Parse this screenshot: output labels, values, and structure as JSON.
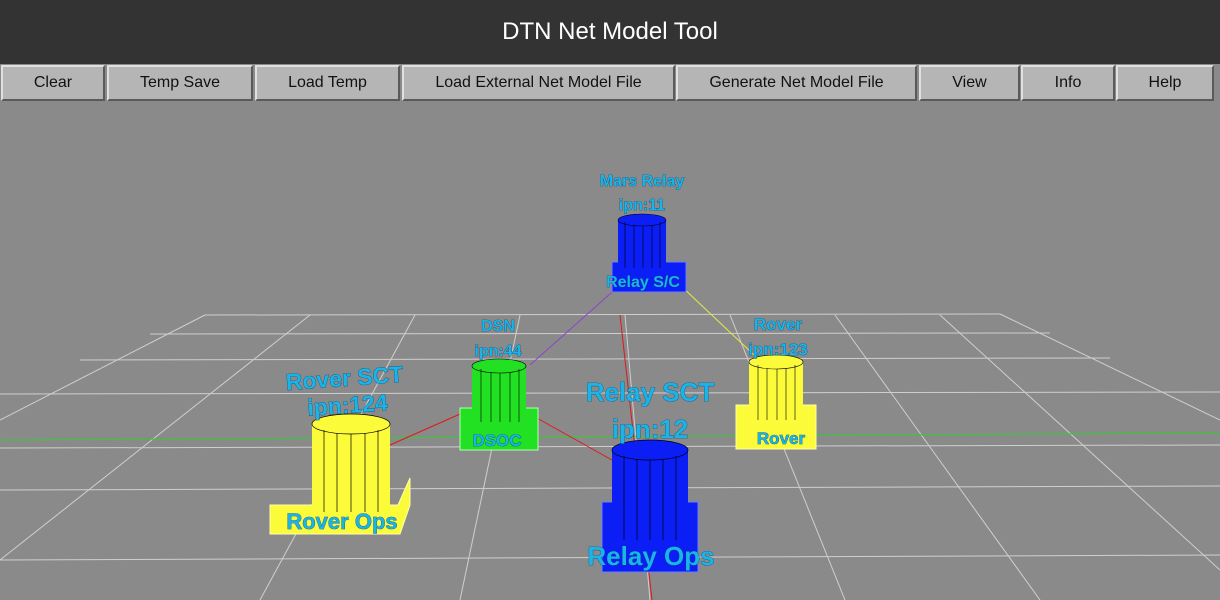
{
  "app": {
    "title": "DTN Net Model Tool"
  },
  "toolbar": {
    "buttons": [
      {
        "id": "clear",
        "label": "Clear"
      },
      {
        "id": "temp-save",
        "label": "Temp Save"
      },
      {
        "id": "load-temp",
        "label": "Load Temp"
      },
      {
        "id": "load-external",
        "label": "Load External Net Model File"
      },
      {
        "id": "generate",
        "label": "Generate Net Model File"
      },
      {
        "id": "view",
        "label": "View"
      },
      {
        "id": "info",
        "label": "Info"
      },
      {
        "id": "help",
        "label": "Help"
      }
    ]
  },
  "scene": {
    "nodes": [
      {
        "id": "mars-relay",
        "name": "Mars Relay",
        "ipn": "ipn:11",
        "platform": "Relay S/C",
        "color": "#0a1ef5"
      },
      {
        "id": "dsn",
        "name": "DSN",
        "ipn": "ipn:44",
        "platform": "DSOC",
        "color": "#22e022"
      },
      {
        "id": "rover",
        "name": "Rover",
        "ipn": "ipn:123",
        "platform": "Rover",
        "color": "#fbfb3a"
      },
      {
        "id": "rover-sct",
        "name": "Rover SCT",
        "ipn": "ipn:124",
        "platform": "Rover Ops",
        "color": "#fbfb3a"
      },
      {
        "id": "relay-sct",
        "name": "Relay SCT",
        "ipn": "ipn:12",
        "platform": "Relay Ops",
        "color": "#0a1ef5"
      }
    ],
    "links": [
      {
        "from": "mars-relay",
        "to": "dsn",
        "color": "#8e44c8"
      },
      {
        "from": "mars-relay",
        "to": "rover",
        "color": "#e8e84a"
      },
      {
        "from": "mars-relay",
        "to": "relay-sct",
        "color": "#e01818"
      },
      {
        "from": "dsn",
        "to": "rover-sct",
        "color": "#e01818"
      },
      {
        "from": "dsn",
        "to": "relay-sct",
        "color": "#e01818"
      }
    ],
    "colors": {
      "background": "#8a8a8a",
      "grid": "#cfcfcf",
      "horizon_axis": "#2fd02f",
      "label_fill": "#19b5e8"
    }
  }
}
